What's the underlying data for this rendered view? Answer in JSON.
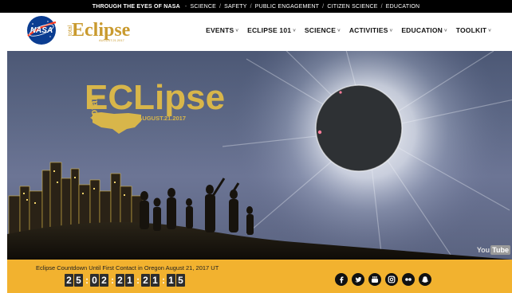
{
  "topbar": {
    "lead": "THROUGH THE EYES OF NASA",
    "links": [
      "SCIENCE",
      "SAFETY",
      "PUBLIC ENGAGEMENT",
      "CITIZEN SCIENCE",
      "EDUCATION"
    ]
  },
  "header": {
    "nasa_logo_text": "NASA",
    "logo": {
      "prefix": "total",
      "word": "Eclipse",
      "tag": "AUGUST.21.2017"
    },
    "nav": [
      {
        "label": "EVENTS"
      },
      {
        "label": "ECLIPSE 101"
      },
      {
        "label": "SCIENCE"
      },
      {
        "label": "ACTIVITIES"
      },
      {
        "label": "EDUCATION"
      },
      {
        "label": "TOOLKIT"
      }
    ]
  },
  "hero": {
    "logo_prefix": "total",
    "logo_word": "ECLipse",
    "logo_date": "AUGUST.21.2017",
    "youtube": {
      "you": "You",
      "tube": "Tube"
    }
  },
  "countdown": {
    "label": "Eclipse Countdown Until First Contact in Oregon August 21, 2017 UT",
    "groups": [
      [
        "2",
        "5"
      ],
      [
        "0",
        "2"
      ],
      [
        "2",
        "1"
      ],
      [
        "2",
        "1"
      ],
      [
        "1",
        "5"
      ]
    ]
  },
  "socials": [
    {
      "name": "facebook-icon",
      "glyph": "f"
    },
    {
      "name": "twitter-icon",
      "glyph": "t"
    },
    {
      "name": "youtube-icon",
      "glyph": "Yt"
    },
    {
      "name": "instagram-icon",
      "glyph": "ig"
    },
    {
      "name": "flickr-icon",
      "glyph": "••"
    },
    {
      "name": "snapchat-icon",
      "glyph": "sc"
    }
  ],
  "colors": {
    "topbar": "#000000",
    "bottombar": "#f2b22f",
    "gold": "#d8b64a",
    "digit_bg": "#2d2d2d"
  }
}
